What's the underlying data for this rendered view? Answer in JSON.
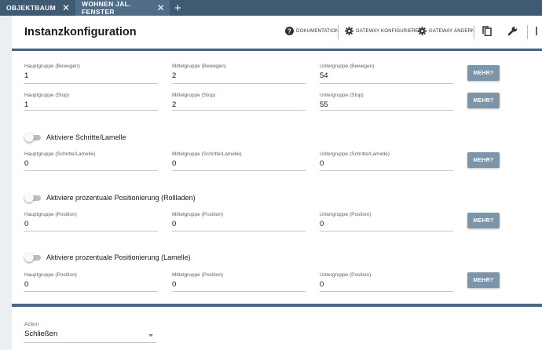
{
  "tabs": [
    {
      "label": "OBJEKTBAUM",
      "active": false
    },
    {
      "label": "WOHNEN JAL. FENSTER",
      "active": true
    }
  ],
  "tab_close_glyph": "✕",
  "tab_add_glyph": "+",
  "page_title": "Instanzkonfiguration",
  "toolbar": {
    "dokumentation": "DOKUMENTATION",
    "gateway_konfigurieren": "GATEWAY KONFIGURIEREN",
    "gateway_aendern": "GATEWAY ÄNDERN"
  },
  "mehr_label": "MEHR?",
  "groups": [
    {
      "toggle_label": "",
      "rows": [
        {
          "haupt_label": "Hauptgruppe (Bewegen)",
          "haupt_value": "1",
          "mittel_label": "Mittelgruppe (Bewegen)",
          "mittel_value": "2",
          "unter_label": "Untergruppe (Bewegen)",
          "unter_value": "54"
        },
        {
          "haupt_label": "Hauptgruppe (Stop)",
          "haupt_value": "1",
          "mittel_label": "Mittelgruppe (Stop)",
          "mittel_value": "2",
          "unter_label": "Untergruppe (Stop)",
          "unter_value": "55"
        }
      ]
    },
    {
      "toggle_label": "Aktiviere Schritte/Lamelle",
      "toggle_on": false,
      "rows": [
        {
          "haupt_label": "Hauptgruppe (Schritte/Lamelle)",
          "haupt_value": "0",
          "mittel_label": "Mittelgruppe (Schritte/Lamelle)",
          "mittel_value": "0",
          "unter_label": "Untergruppe (Schritte/Lamelle)",
          "unter_value": "0"
        }
      ]
    },
    {
      "toggle_label": "Aktiviere prozentuale Positionierung (Rollladen)",
      "toggle_on": false,
      "rows": [
        {
          "haupt_label": "Hauptgruppe (Position)",
          "haupt_value": "0",
          "mittel_label": "Mittelgruppe (Position)",
          "mittel_value": "0",
          "unter_label": "Untergruppe (Position)",
          "unter_value": "0"
        }
      ]
    },
    {
      "toggle_label": "Aktiviere prozentuale Positionierung (Lamelle)",
      "toggle_on": false,
      "rows": [
        {
          "haupt_label": "Hauptgruppe (Position)",
          "haupt_value": "0",
          "mittel_label": "Mittelgruppe (Position)",
          "mittel_value": "0",
          "unter_label": "Untergruppe (Position)",
          "unter_value": "0"
        }
      ]
    }
  ],
  "action": {
    "label": "Action",
    "value": "Schließen"
  },
  "colors": {
    "tabbar": "#3f5a73",
    "tab_active": "#4f6c88",
    "accent_strip": "#4a6785",
    "mehr_button": "#7d95a8"
  }
}
